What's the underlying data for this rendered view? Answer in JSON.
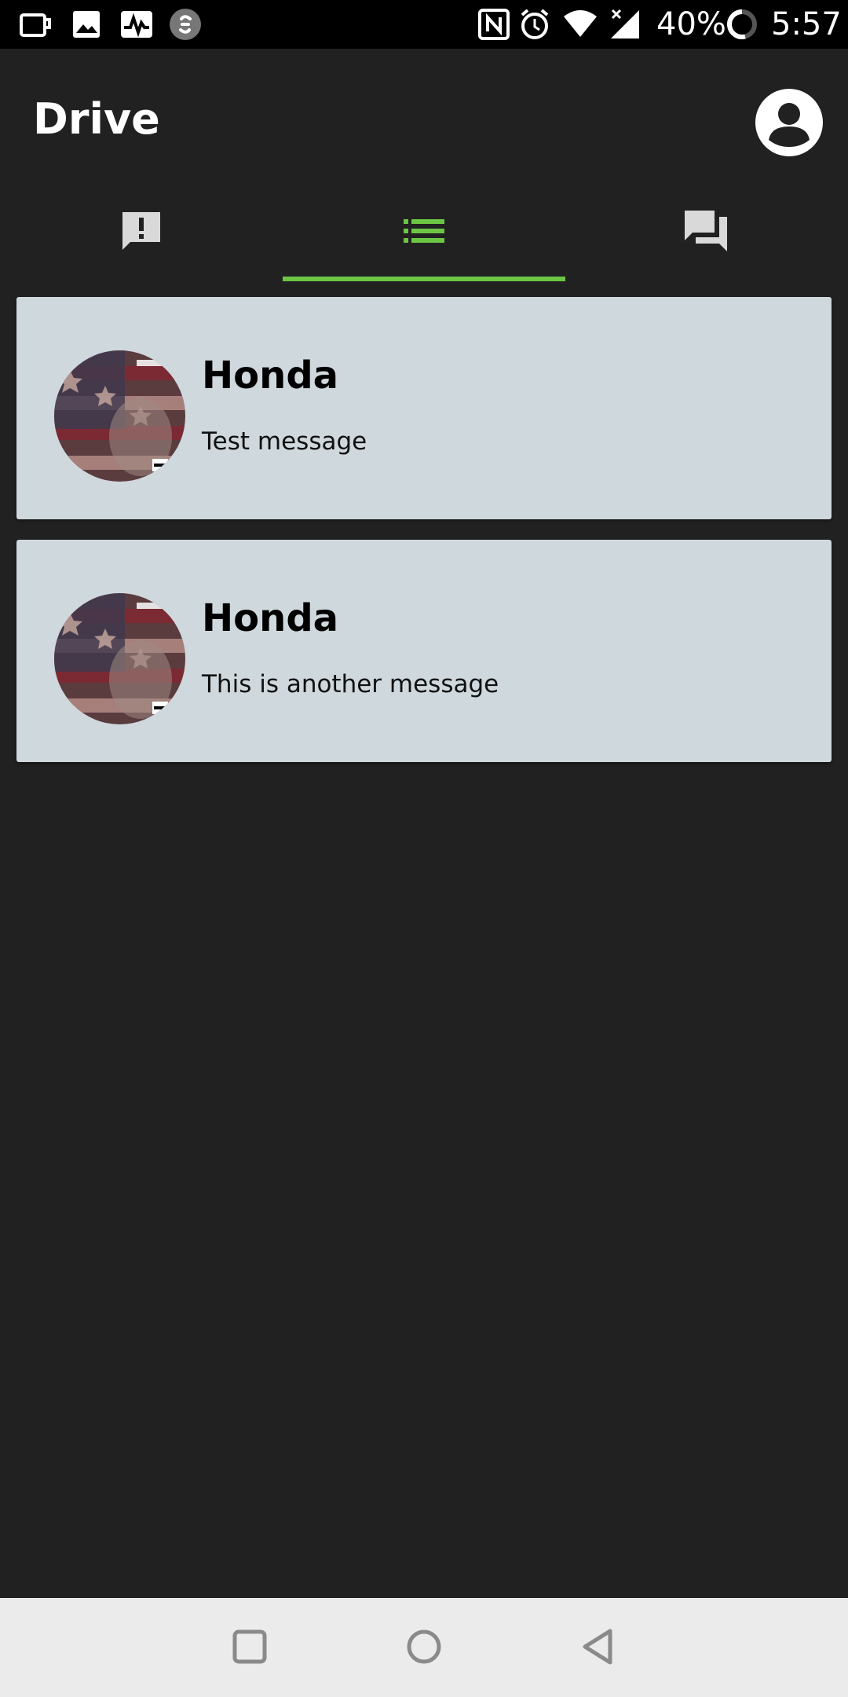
{
  "status_bar": {
    "battery_percent": "40%",
    "time": "5:57",
    "icons": [
      "coffee-cup-icon",
      "image-icon",
      "pulse-icon",
      "shazam-icon",
      "nfc-icon",
      "alarm-icon",
      "wifi-icon",
      "signal-icon",
      "battery-icon"
    ]
  },
  "app_bar": {
    "title": "Drive",
    "account_icon": "account-circle-icon"
  },
  "tabs": [
    {
      "icon": "alert-message-icon",
      "selected": false
    },
    {
      "icon": "list-icon",
      "selected": true
    },
    {
      "icon": "forum-icon",
      "selected": false
    }
  ],
  "messages": [
    {
      "sender": "Honda",
      "text": "Test message",
      "avatar": "album-cover-avatar"
    },
    {
      "sender": "Honda",
      "text": "This is another message",
      "avatar": "album-cover-avatar"
    }
  ],
  "nav_bar": {
    "icons": [
      "recents-square-icon",
      "home-circle-icon",
      "back-triangle-icon"
    ]
  },
  "colors": {
    "background": "#212121",
    "accent": "#6cc644",
    "card": "#cfd8dc",
    "tab_icon_inactive": "#d9d9d9"
  }
}
